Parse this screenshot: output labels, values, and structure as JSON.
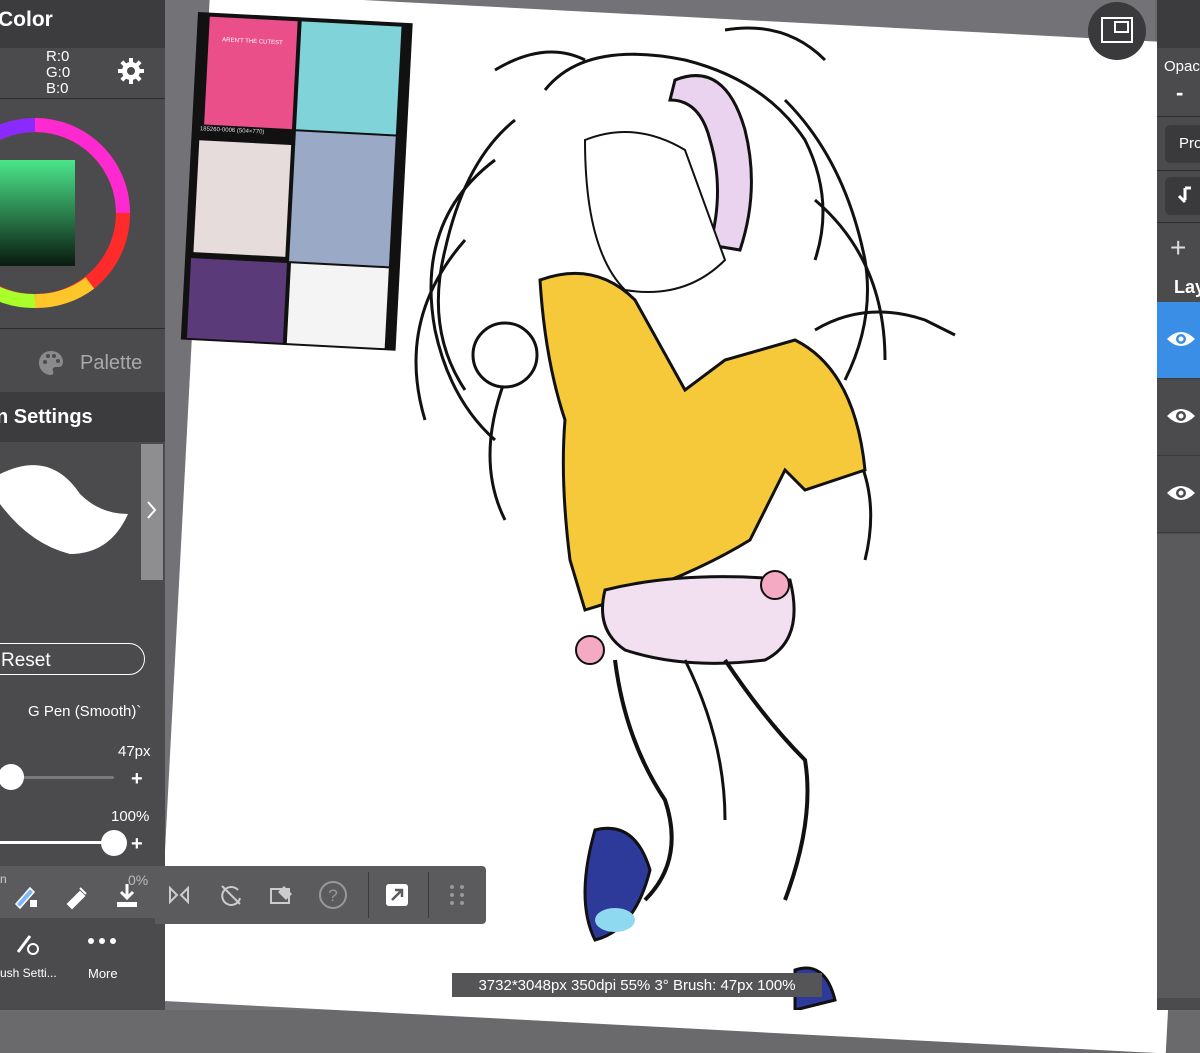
{
  "color_panel": {
    "title": "Color",
    "r": "R:0",
    "g": "G:0",
    "b": "B:0",
    "palette_label": "Palette"
  },
  "brush_panel": {
    "title": "n Settings",
    "reset_label": "Reset",
    "brush_name": "G Pen (Smooth)`",
    "size_value": "47px",
    "opacity_value": "100%",
    "size_level": 0.1,
    "opacity_level": 1.0
  },
  "toolbar": {
    "tool_snippet_left": "n",
    "tool_snippet_pct": "0%",
    "brush_settings_label": "rush Setti...",
    "more_label": "More"
  },
  "right_panel": {
    "opacity_label": "Opac",
    "minus_label": "-",
    "pro_label": "Pro",
    "layer_label": "Lay"
  },
  "status": {
    "text": "3732*3048px 350dpi 55% 3° Brush: 47px 100%"
  },
  "reference_image": {
    "caption": "185260-0006 (504×770)",
    "shirt_text": "AREN'T THE CUTEST"
  },
  "colors": {
    "panel": "#4b4b4d",
    "header": "#3c3c3e",
    "accent_blue": "#3a8ee6",
    "shirt_yellow": "#f5c93a"
  }
}
